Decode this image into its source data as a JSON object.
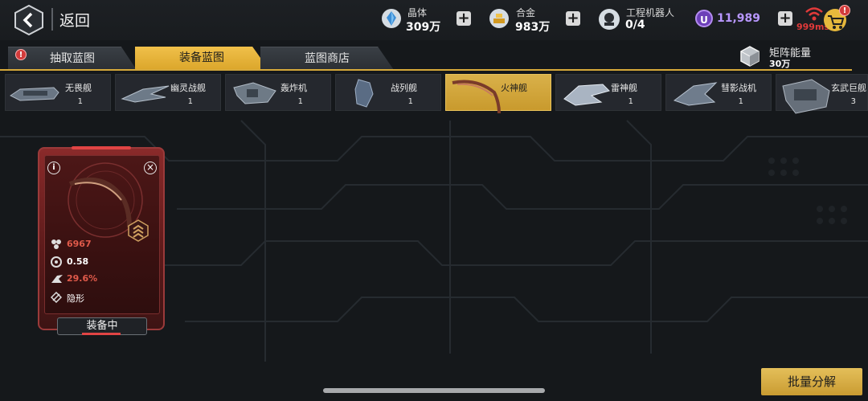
{
  "header": {
    "back_label": "返回",
    "crystal": {
      "label": "晶体",
      "value": "309万"
    },
    "alloy": {
      "label": "合金",
      "value": "983万"
    },
    "robots": {
      "label": "工程机器人",
      "value": "0/4"
    },
    "u_currency": {
      "badge": "U",
      "value": "11,989"
    },
    "ping": "999ms",
    "alert_glyph": "!"
  },
  "tabs": [
    {
      "label": "抽取蓝图",
      "alert": "!"
    },
    {
      "label": "装备蓝图"
    },
    {
      "label": "蓝图商店"
    }
  ],
  "matrix_energy": {
    "label": "矩阵能量",
    "value": "30万"
  },
  "ships": [
    {
      "name": "无畏舰",
      "count": "1"
    },
    {
      "name": "幽灵战舰",
      "count": "1"
    },
    {
      "name": "轰炸机",
      "count": "1"
    },
    {
      "name": "战列舰",
      "count": "1"
    },
    {
      "name": "火神舰",
      "count": ""
    },
    {
      "name": "雷神舰",
      "count": "1"
    },
    {
      "name": "彗影战机",
      "count": "1"
    },
    {
      "name": "玄武巨舰",
      "count": "3"
    }
  ],
  "card": {
    "info_glyph": "i",
    "close_glyph": "×",
    "stats": [
      {
        "icon": "cluster-icon",
        "value": "6967",
        "color": "#e05a4a"
      },
      {
        "icon": "gear-icon",
        "value": "0.58",
        "color": "#ffffff"
      },
      {
        "icon": "ship-speed-icon",
        "value": "29.6%",
        "color": "#e05a4a"
      },
      {
        "icon": "stealth-icon",
        "value": "隐形",
        "color": "#ffffff"
      }
    ],
    "equip_label": "装备中"
  },
  "footer": {
    "batch_label": "批量分解"
  },
  "colors": {
    "accent": "#dca72c",
    "card_red": "#8a2a2a",
    "u_purple": "#6c3fb8"
  }
}
